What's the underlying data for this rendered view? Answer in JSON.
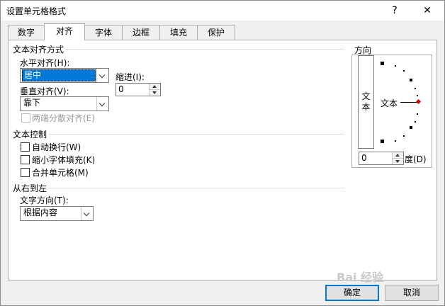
{
  "window": {
    "title": "设置单元格格式",
    "help_label": "?",
    "close_label": "✕"
  },
  "tabs": [
    {
      "label": "数字",
      "active": false
    },
    {
      "label": "对齐",
      "active": true
    },
    {
      "label": "字体",
      "active": false
    },
    {
      "label": "边框",
      "active": false
    },
    {
      "label": "填充",
      "active": false
    },
    {
      "label": "保护",
      "active": false
    }
  ],
  "text_alignment": {
    "group_title": "文本对齐方式",
    "horizontal_label": "水平对齐(H):",
    "horizontal_value": "居中",
    "indent_label": "缩进(I):",
    "indent_value": "0",
    "vertical_label": "垂直对齐(V):",
    "vertical_value": "靠下",
    "distributed_label": "两端分散对齐(E)"
  },
  "text_control": {
    "group_title": "文本控制",
    "wrap_label": "自动换行(W)",
    "shrink_label": "缩小字体填充(K)",
    "merge_label": "合并单元格(M)"
  },
  "rtl": {
    "group_title": "从右到左",
    "direction_label": "文字方向(T):",
    "direction_value": "根据内容"
  },
  "orientation": {
    "group_title": "方向",
    "vertical_text_1": "文",
    "vertical_text_2": "本",
    "text_label": "文本",
    "degree_value": "0",
    "degree_label": "度(D)",
    "marker_color": "#d40000"
  },
  "buttons": {
    "ok_label": "确定",
    "cancel_label": "取消"
  },
  "watermark": {
    "text": "Bai 经验"
  }
}
